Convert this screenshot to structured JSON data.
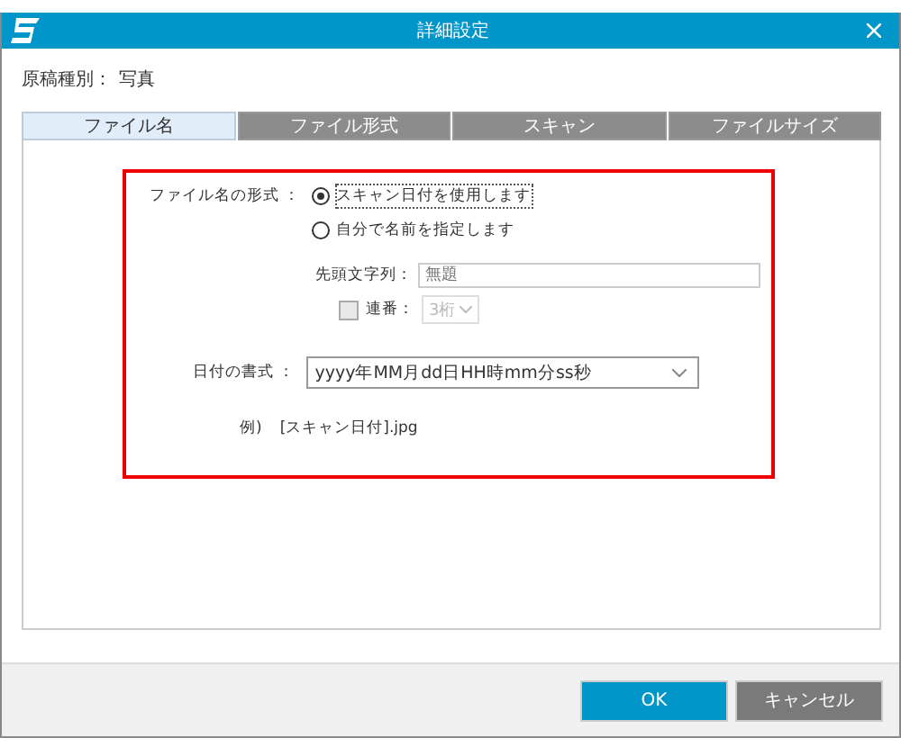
{
  "window": {
    "title": "詳細設定"
  },
  "document_type": {
    "label": "原稿種別：",
    "value": "写真"
  },
  "tabs": [
    {
      "label": "ファイル名",
      "selected": true
    },
    {
      "label": "ファイル形式",
      "selected": false
    },
    {
      "label": "スキャン",
      "selected": false
    },
    {
      "label": "ファイルサイズ",
      "selected": false
    }
  ],
  "file_name_format": {
    "label": "ファイル名の形式 ：",
    "options": [
      {
        "label": "スキャン日付を使用します",
        "selected": true
      },
      {
        "label": "自分で名前を指定します",
        "selected": false
      }
    ]
  },
  "prefix": {
    "label": "先頭文字列：",
    "placeholder": "無題"
  },
  "serial": {
    "label": "連番：",
    "checked": false,
    "value": "3桁",
    "disabled": true
  },
  "date_format": {
    "label": "日付の書式 ：",
    "value": "yyyy年MM月dd日HH時mm分ss秒"
  },
  "example": {
    "label": "例)",
    "value": "[スキャン日付].jpg"
  },
  "buttons": [
    {
      "label": "OK",
      "kind": "primary"
    },
    {
      "label": "キャンセル",
      "kind": "secondary"
    }
  ]
}
